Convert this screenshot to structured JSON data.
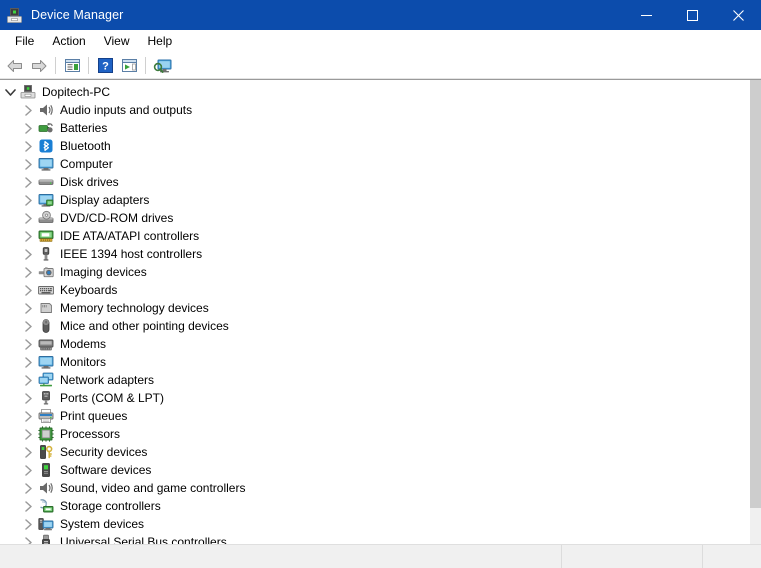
{
  "window": {
    "title": "Device Manager",
    "icon": "device-manager-icon",
    "titlebar_color": "#0c4cac",
    "controls": {
      "minimize": "minimize",
      "maximize": "maximize",
      "close": "close"
    }
  },
  "menubar": {
    "items": [
      {
        "label": "File",
        "name": "menu-file"
      },
      {
        "label": "Action",
        "name": "menu-action"
      },
      {
        "label": "View",
        "name": "menu-view"
      },
      {
        "label": "Help",
        "name": "menu-help"
      }
    ]
  },
  "toolbar": {
    "items": [
      {
        "icon": "back-arrow-icon",
        "name": "toolbar-back-button",
        "type": "button"
      },
      {
        "icon": "forward-arrow-icon",
        "name": "toolbar-forward-button",
        "type": "button"
      },
      {
        "type": "separator"
      },
      {
        "icon": "properties-icon",
        "name": "toolbar-properties-button",
        "type": "button"
      },
      {
        "type": "separator"
      },
      {
        "icon": "help-icon",
        "name": "toolbar-help-button",
        "type": "button"
      },
      {
        "icon": "update-driver-icon",
        "name": "toolbar-update-driver-button",
        "type": "button"
      },
      {
        "type": "separator"
      },
      {
        "icon": "scan-hardware-changes-icon",
        "name": "toolbar-scan-hardware-button",
        "type": "button"
      }
    ]
  },
  "tree": {
    "root": {
      "label": "Dopitech-PC",
      "icon": "computer-root-icon",
      "expanded": true
    },
    "nodes": [
      {
        "label": "Audio inputs and outputs",
        "icon": "speaker-icon",
        "expanded": false
      },
      {
        "label": "Batteries",
        "icon": "battery-icon",
        "expanded": false
      },
      {
        "label": "Bluetooth",
        "icon": "bluetooth-icon",
        "expanded": false
      },
      {
        "label": "Computer",
        "icon": "monitor-icon",
        "expanded": false
      },
      {
        "label": "Disk drives",
        "icon": "disk-drive-icon",
        "expanded": false
      },
      {
        "label": "Display adapters",
        "icon": "display-adapter-icon",
        "expanded": false
      },
      {
        "label": "DVD/CD-ROM drives",
        "icon": "dvd-drive-icon",
        "expanded": false
      },
      {
        "label": "IDE ATA/ATAPI controllers",
        "icon": "ide-controller-icon",
        "expanded": false
      },
      {
        "label": "IEEE 1394 host controllers",
        "icon": "firewire-icon",
        "expanded": false
      },
      {
        "label": "Imaging devices",
        "icon": "camera-icon",
        "expanded": false
      },
      {
        "label": "Keyboards",
        "icon": "keyboard-icon",
        "expanded": false
      },
      {
        "label": "Memory technology devices",
        "icon": "memory-card-icon",
        "expanded": false
      },
      {
        "label": "Mice and other pointing devices",
        "icon": "mouse-icon",
        "expanded": false
      },
      {
        "label": "Modems",
        "icon": "modem-icon",
        "expanded": false
      },
      {
        "label": "Monitors",
        "icon": "monitor-icon",
        "expanded": false
      },
      {
        "label": "Network adapters",
        "icon": "network-adapter-icon",
        "expanded": false
      },
      {
        "label": "Ports (COM & LPT)",
        "icon": "port-connector-icon",
        "expanded": false
      },
      {
        "label": "Print queues",
        "icon": "printer-icon",
        "expanded": false
      },
      {
        "label": "Processors",
        "icon": "processor-chip-icon",
        "expanded": false
      },
      {
        "label": "Security devices",
        "icon": "security-key-icon",
        "expanded": false
      },
      {
        "label": "Software devices",
        "icon": "software-device-icon",
        "expanded": false
      },
      {
        "label": "Sound, video and game controllers",
        "icon": "speaker-icon",
        "expanded": false
      },
      {
        "label": "Storage controllers",
        "icon": "storage-controller-icon",
        "expanded": false
      },
      {
        "label": "System devices",
        "icon": "system-device-icon",
        "expanded": false
      },
      {
        "label": "Universal Serial Bus controllers",
        "icon": "usb-icon",
        "expanded": false
      }
    ]
  },
  "scrollbar": {
    "orientation": "vertical",
    "name": "tree-vertical-scrollbar"
  },
  "statusbar": {
    "pane1": "",
    "pane2": "",
    "pane3": ""
  }
}
